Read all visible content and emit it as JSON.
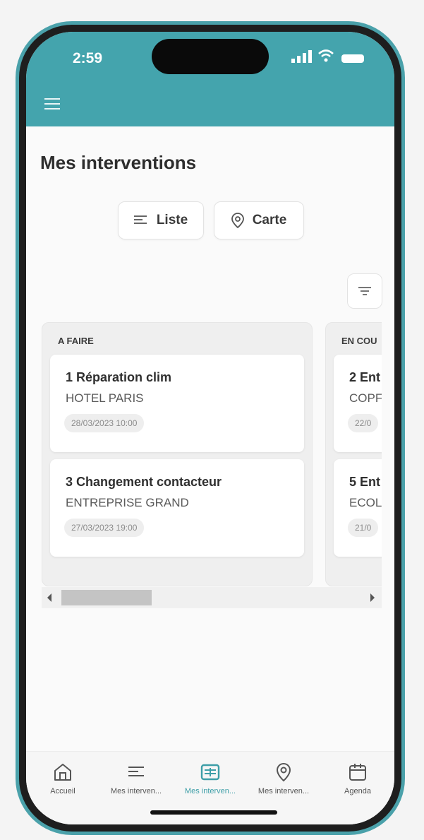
{
  "status_bar": {
    "time": "2:59"
  },
  "header": {
    "menu_icon": "hamburger-menu-icon",
    "bg_color": "#44a4ad"
  },
  "page": {
    "title": "Mes interventions"
  },
  "view_toggle": [
    {
      "label": "Liste",
      "icon": "list-icon"
    },
    {
      "label": "Carte",
      "icon": "map-pin-icon"
    }
  ],
  "filter": {
    "icon": "filter-icon"
  },
  "columns": [
    {
      "title": "A FAIRE",
      "cards": [
        {
          "title": "1 Réparation clim",
          "subtitle": "HOTEL PARIS",
          "date": "28/03/2023 10:00"
        },
        {
          "title": "3 Changement contacteur",
          "subtitle": "ENTREPRISE GRAND",
          "date": "27/03/2023 19:00"
        }
      ]
    },
    {
      "title": "EN COU",
      "cards": [
        {
          "title": "2 Ent",
          "subtitle": "COPF",
          "date": "22/0"
        },
        {
          "title": "5 Ent",
          "subtitle": "ECOL",
          "date": "21/0"
        }
      ]
    }
  ],
  "bottom_nav": [
    {
      "label": "Accueil",
      "icon": "home-icon",
      "active": false
    },
    {
      "label": "Mes interven...",
      "icon": "list-icon",
      "active": false
    },
    {
      "label": "Mes interven...",
      "icon": "kanban-board-icon",
      "active": true
    },
    {
      "label": "Mes interven...",
      "icon": "map-pin-icon",
      "active": false
    },
    {
      "label": "Agenda",
      "icon": "calendar-icon",
      "active": false
    }
  ],
  "colors": {
    "accent": "#44a4ad",
    "frame": "#4aa1aa"
  }
}
